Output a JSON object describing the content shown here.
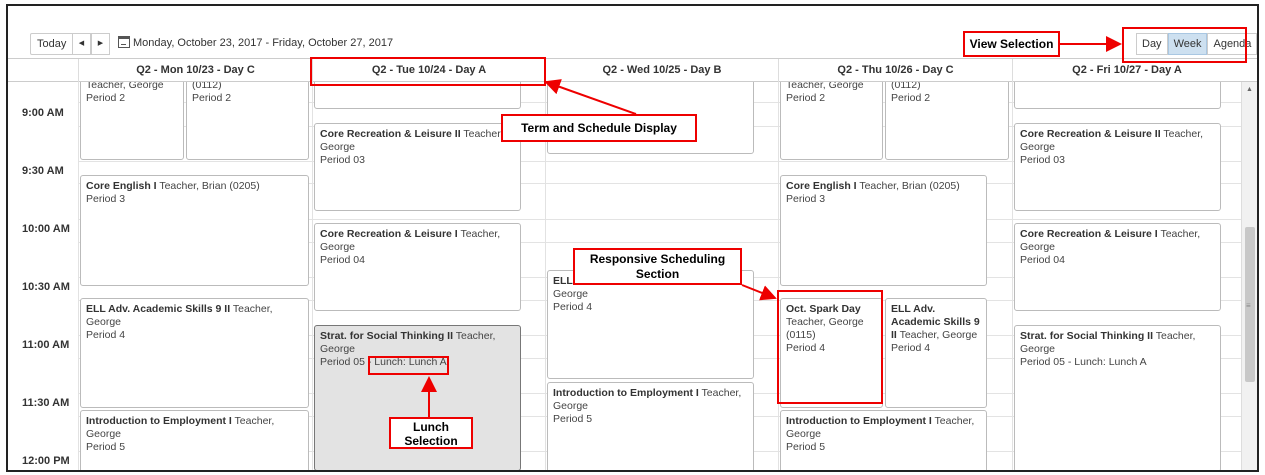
{
  "toolbar": {
    "today_label": "Today",
    "prev_icon": "◀",
    "next_icon": "▶",
    "date_range": "Monday, October 23, 2017 - Friday, October 27, 2017",
    "view_buttons": [
      "Day",
      "Week",
      "Agenda"
    ],
    "active_view": "Week"
  },
  "days": [
    "Q2 - Mon 10/23 - Day C",
    "Q2 - Tue 10/24 - Day A",
    "Q2 - Wed 10/25 - Day B",
    "Q2 - Thu 10/26 - Day C",
    "Q2 - Fri 10/27 - Day A"
  ],
  "times": [
    "9:00 AM",
    "9:30 AM",
    "10:00 AM",
    "10:30 AM",
    "11:00 AM",
    "11:30 AM",
    "12:00 PM"
  ],
  "events": {
    "mon_p2a": {
      "title": "",
      "line1": "Teacher, George",
      "line2": "Period 2"
    },
    "mon_p2b": {
      "title": "",
      "line1": "(0112)",
      "line2": "Period 2"
    },
    "mon_p3": {
      "title": "Core English I",
      "teacher": " Teacher, Brian (0205)",
      "line2": "Period 3"
    },
    "mon_p4": {
      "title": "ELL Adv. Academic Skills 9 II",
      "teacher": " Teacher, George",
      "line2": "Period 4"
    },
    "mon_p5": {
      "title": "Introduction to Employment I",
      "teacher": " Teacher, George",
      "line2": "Period 5"
    },
    "tue_p3": {
      "title": "Core Recreation & Leisure II",
      "teacher": " Teacher, George",
      "line2": "Period 03"
    },
    "tue_p4": {
      "title": "Core Recreation & Leisure I",
      "teacher": " Teacher, George",
      "line2": "Period 04"
    },
    "tue_p5": {
      "title": "Strat. for Social Thinking II",
      "teacher": " Teacher, George",
      "period": "Period 05 - ",
      "lunch": "Lunch: Lunch A"
    },
    "wed_p4": {
      "title": "ELL",
      "line1": "George",
      "line2": "Period 4"
    },
    "wed_p5": {
      "title": "Introduction to Employment I",
      "teacher": " Teacher, George",
      "line2": "Period 5"
    },
    "thu_p2a": {
      "title": "",
      "line1": "Teacher, George",
      "line2": "Period 2"
    },
    "thu_p2b": {
      "title": "",
      "line1": "(0112)",
      "line2": "Period 2"
    },
    "thu_p3": {
      "title": "Core English I",
      "teacher": " Teacher, Brian (0205)",
      "line2": "Period 3"
    },
    "thu_p4a": {
      "title": "Oct. Spark Day",
      "line1": "Teacher, George",
      "line1b": "(0115)",
      "line2": "Period 4"
    },
    "thu_p4b": {
      "title": "ELL Adv. Academic Skills 9 II",
      "teacher": " Teacher, George",
      "line2": "Period 4"
    },
    "thu_p5": {
      "title": "Introduction to Employment I",
      "teacher": " Teacher, George",
      "line2": "Period 5"
    },
    "fri_p3": {
      "title": "Core Recreation & Leisure II",
      "teacher": " Teacher, George",
      "line2": "Period 03"
    },
    "fri_p4": {
      "title": "Core Recreation & Leisure I",
      "teacher": " Teacher, George",
      "line2": "Period 04"
    },
    "fri_p5": {
      "title": "Strat. for Social Thinking II",
      "teacher": " Teacher, George",
      "line2": "Period 05 - Lunch: Lunch A"
    }
  },
  "callouts": {
    "view_selection": "View Selection",
    "term_schedule": "Term and Schedule Display",
    "responsive_line1": "Responsive Scheduling",
    "responsive_line2": "Section",
    "lunch_line1": "Lunch",
    "lunch_line2": "Selection"
  },
  "colors": {
    "annotation": "#e00000",
    "active_view": "#cde0f0",
    "selected_event": "#e3e3e3"
  }
}
